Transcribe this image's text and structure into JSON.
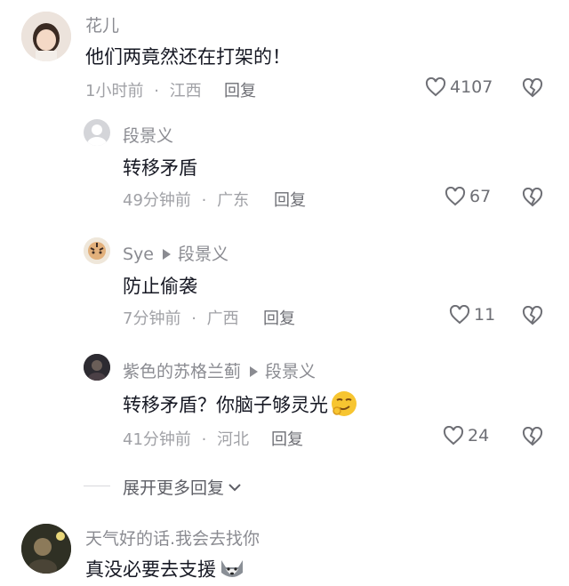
{
  "comments": [
    {
      "id": "c1",
      "author": "花儿",
      "text": "他们两竟然还在打架的！",
      "time": "1小时前",
      "location": "江西",
      "reply_label": "回复",
      "likes": "4107"
    }
  ],
  "replies": [
    {
      "id": "r1",
      "author": "段景义",
      "reply_to": "",
      "text": "转移矛盾",
      "time": "49分钟前",
      "location": "广东",
      "reply_label": "回复",
      "likes": "67"
    },
    {
      "id": "r2",
      "author": "Sye",
      "reply_to": "段景义",
      "text": "防止偷袭",
      "time": "7分钟前",
      "location": "广西",
      "reply_label": "回复",
      "likes": "11"
    },
    {
      "id": "r3",
      "author": "紫色的苏格兰蓟",
      "reply_to": "段景义",
      "text": "转移矛盾？你脑子够灵光",
      "time": "41分钟前",
      "location": "河北",
      "reply_label": "回复",
      "likes": "24"
    }
  ],
  "expand_replies_label": "展开更多回复",
  "comment2": {
    "author": "天气好的话.我会去找你",
    "text": "真没必要去支援"
  },
  "separator": "·",
  "icons": {
    "like": "heart-outline-icon",
    "dislike": "broken-heart-icon",
    "reply_arrow": "triangle-right-icon",
    "expand": "chevron-down-icon",
    "emoji_smirk": "smirk-emoji-icon",
    "emoji_doge": "doge-emoji-icon"
  },
  "colors": {
    "primary_text": "#161823",
    "secondary_text": "#8a8b91",
    "meta_text": "#a0a1a6",
    "icon": "#6e6f75"
  }
}
